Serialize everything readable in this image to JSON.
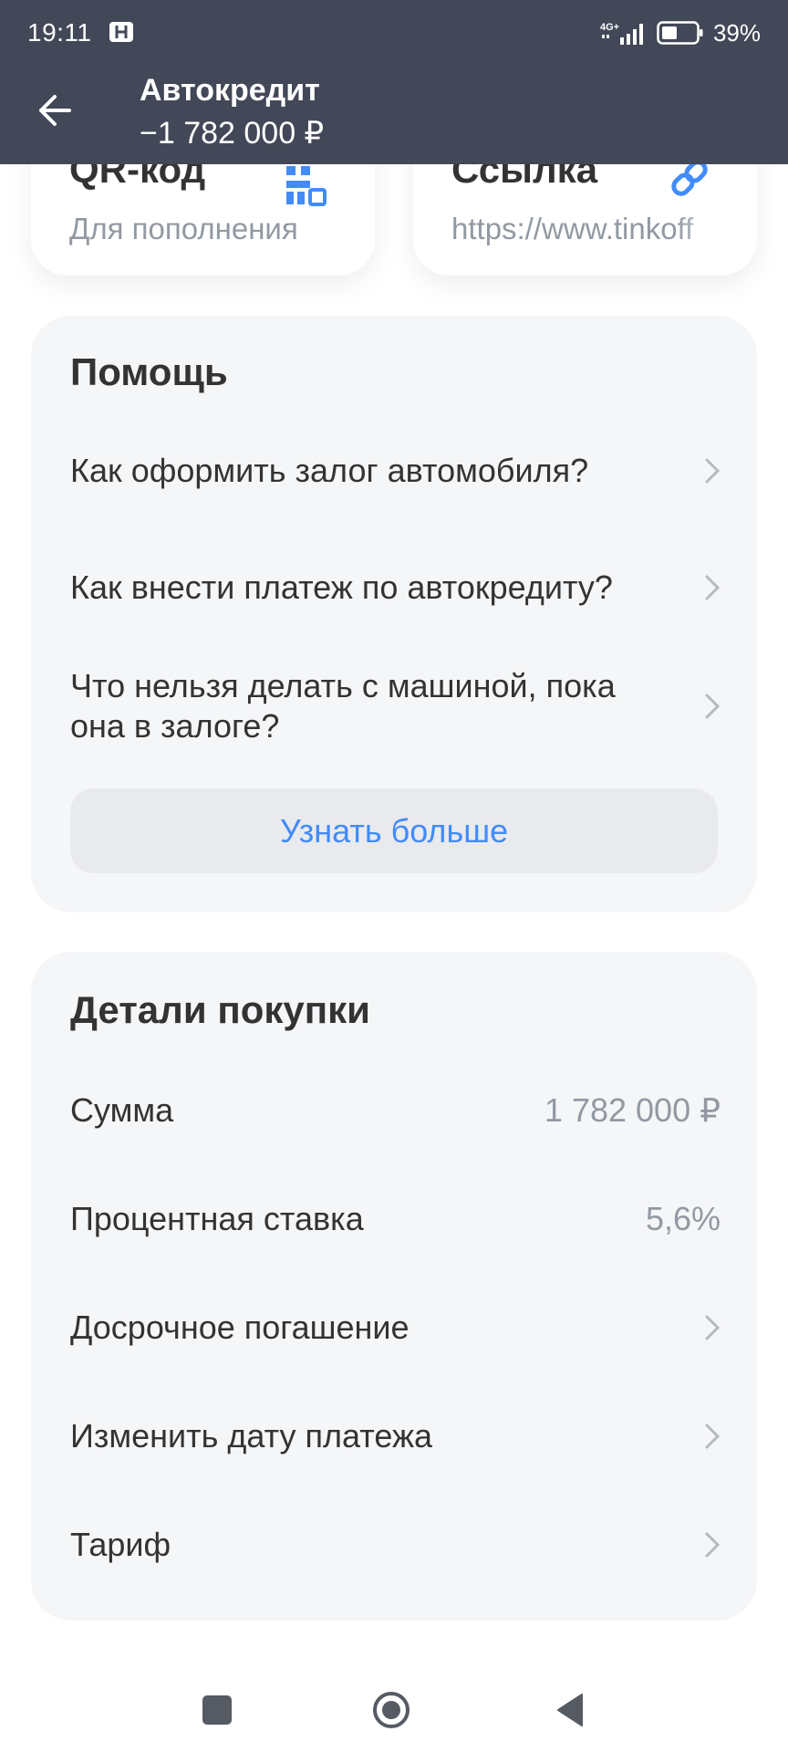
{
  "status_bar": {
    "time": "19:11",
    "network": "4G+",
    "battery": "39%"
  },
  "header": {
    "title": "Автокредит",
    "amount": "−1 782 000 ₽"
  },
  "top_cards": [
    {
      "title": "QR-код",
      "subtitle": "Для пополнения",
      "icon": "qr-code-icon"
    },
    {
      "title": "Ссылка",
      "subtitle": "https://www.tinkoff",
      "icon": "link-icon"
    }
  ],
  "help": {
    "title": "Помощь",
    "items": [
      {
        "label": "Как оформить залог автомобиля?"
      },
      {
        "label": "Как внести платеж по автокредиту?"
      },
      {
        "label": "Что нельзя делать с машиной, пока она в залоге?"
      }
    ],
    "more_label": "Узнать больше"
  },
  "details": {
    "title": "Детали покупки",
    "rows": [
      {
        "label": "Сумма",
        "value": "1 782 000 ₽"
      },
      {
        "label": "Процентная ставка",
        "value": "5,6%"
      },
      {
        "label": "Досрочное погашение"
      },
      {
        "label": "Изменить дату платежа"
      },
      {
        "label": "Тариф"
      }
    ]
  },
  "colors": {
    "header_bg": "#424857",
    "card_bg": "#f5f6f8",
    "accent": "#428bf9",
    "muted_text": "#9299a2"
  }
}
